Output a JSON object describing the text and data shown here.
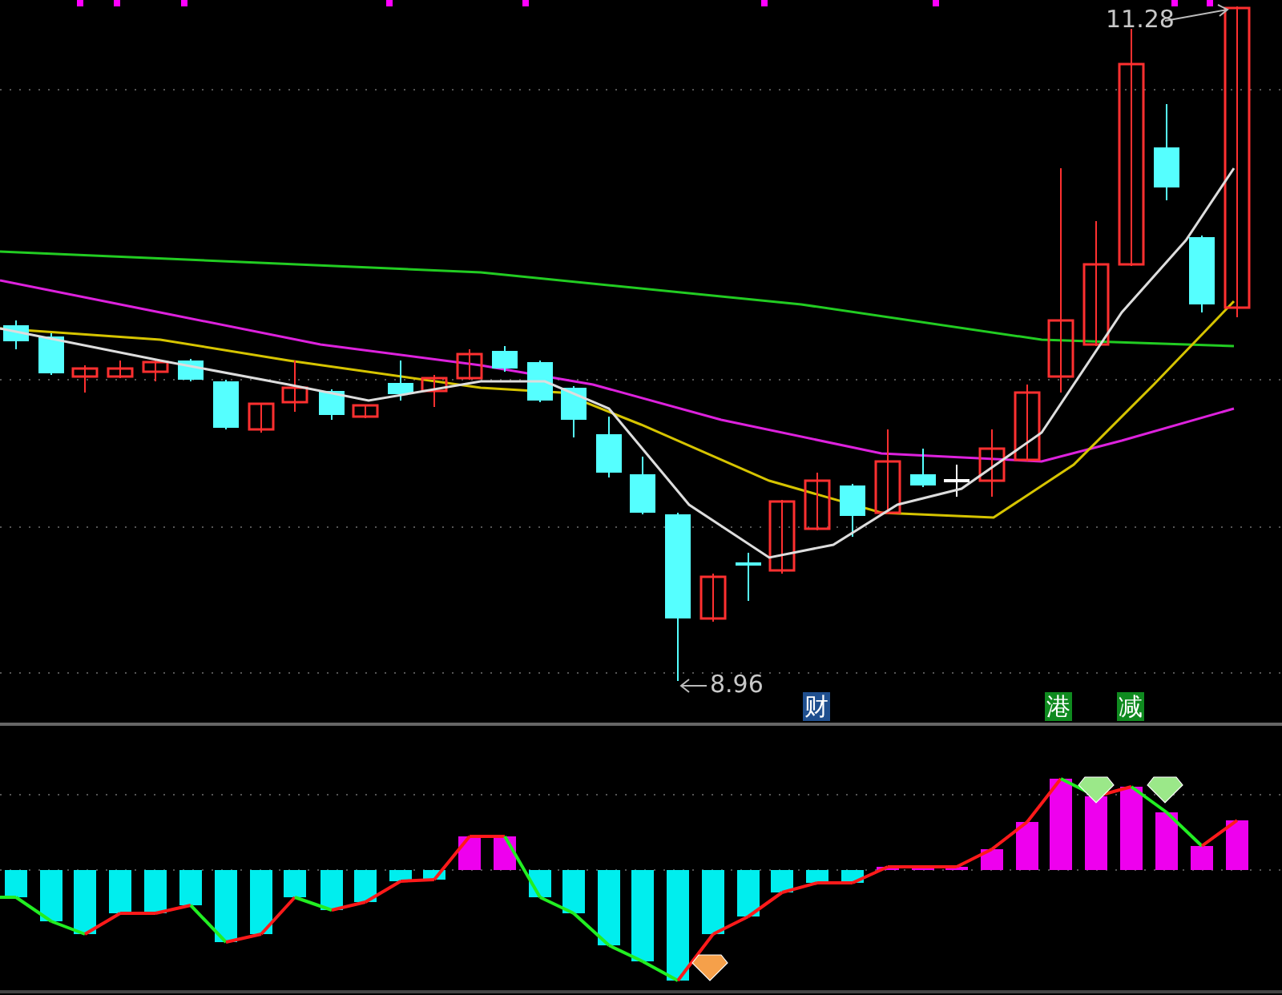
{
  "price_chart": {
    "high_label": "11.28",
    "low_label": "8.96",
    "event_tags": [
      {
        "label": "财",
        "color": "#1f4f8f"
      },
      {
        "label": "港",
        "color": "#0f8a1f"
      },
      {
        "label": "减",
        "color": "#0f8a1f"
      }
    ]
  }
}
